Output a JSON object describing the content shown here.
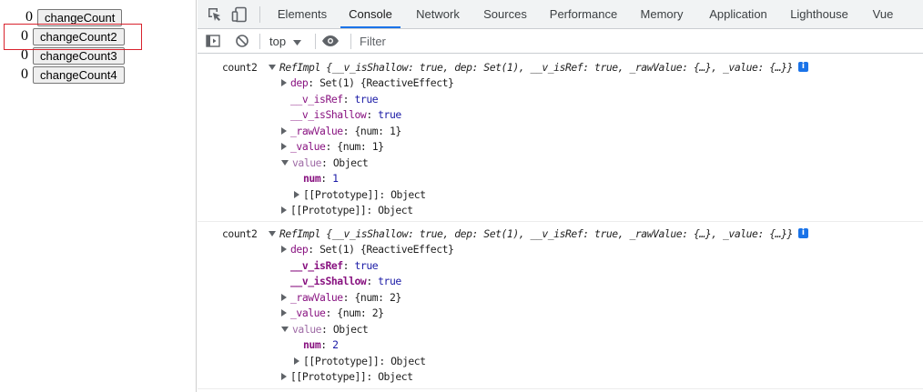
{
  "page": {
    "rows": [
      {
        "count": "0",
        "label": "changeCount"
      },
      {
        "count": "0",
        "label": "changeCount2"
      },
      {
        "count": "0",
        "label": "changeCount3"
      },
      {
        "count": "0",
        "label": "changeCount4"
      }
    ]
  },
  "devtools": {
    "tabs": [
      "Elements",
      "Console",
      "Network",
      "Sources",
      "Performance",
      "Memory",
      "Application",
      "Lighthouse",
      "Vue"
    ],
    "active_tab": "Console",
    "context": "top",
    "filter_placeholder": "Filter",
    "icons": [
      "inspect-element-icon",
      "device-toggle-icon",
      "sidebar-toggle-icon",
      "clear-console-icon",
      "dropdown-arrow-icon",
      "eye-icon",
      "info-icon"
    ]
  },
  "console": {
    "messages": [
      {
        "label": "count2",
        "summary": {
          "class": "RefImpl",
          "text": "{__v_isShallow: true, dep: Set(1), __v_isRef: true, _rawValue: {…}, _value: {…}}"
        },
        "badge": "i",
        "props": {
          "dep_name": "dep",
          "dep_value": "Set(1) {ReactiveEffect}",
          "isRef_name": "__v_isRef",
          "isRef_value": "true",
          "isShallow_name": "__v_isShallow",
          "isShallow_value": "true",
          "rawValue_name": "_rawValue",
          "rawValue_value": "{num: 1}",
          "value_name": "_value",
          "value_value": "{num: 1}",
          "getter_name": "value",
          "getter_value": "Object",
          "num_name": "num",
          "num_value": "1",
          "proto_inner_name": "[[Prototype]]",
          "proto_inner_value": "Object",
          "proto_name": "[[Prototype]]",
          "proto_value": "Object"
        }
      },
      {
        "label": "count2",
        "summary": {
          "class": "RefImpl",
          "text": "{__v_isShallow: true, dep: Set(1), __v_isRef: true, _rawValue: {…}, _value: {…}}"
        },
        "badge": "i",
        "props": {
          "dep_name": "dep",
          "dep_value": "Set(1) {ReactiveEffect}",
          "isRef_name": "__v_isRef",
          "isRef_value": "true",
          "isShallow_name": "__v_isShallow",
          "isShallow_value": "true",
          "rawValue_name": "_rawValue",
          "rawValue_value": "{num: 2}",
          "value_name": "_value",
          "value_value": "{num: 2}",
          "getter_name": "value",
          "getter_value": "Object",
          "num_name": "num",
          "num_value": "2",
          "proto_inner_name": "[[Prototype]]",
          "proto_inner_value": "Object",
          "proto_name": "[[Prototype]]",
          "proto_value": "Object"
        }
      }
    ]
  }
}
